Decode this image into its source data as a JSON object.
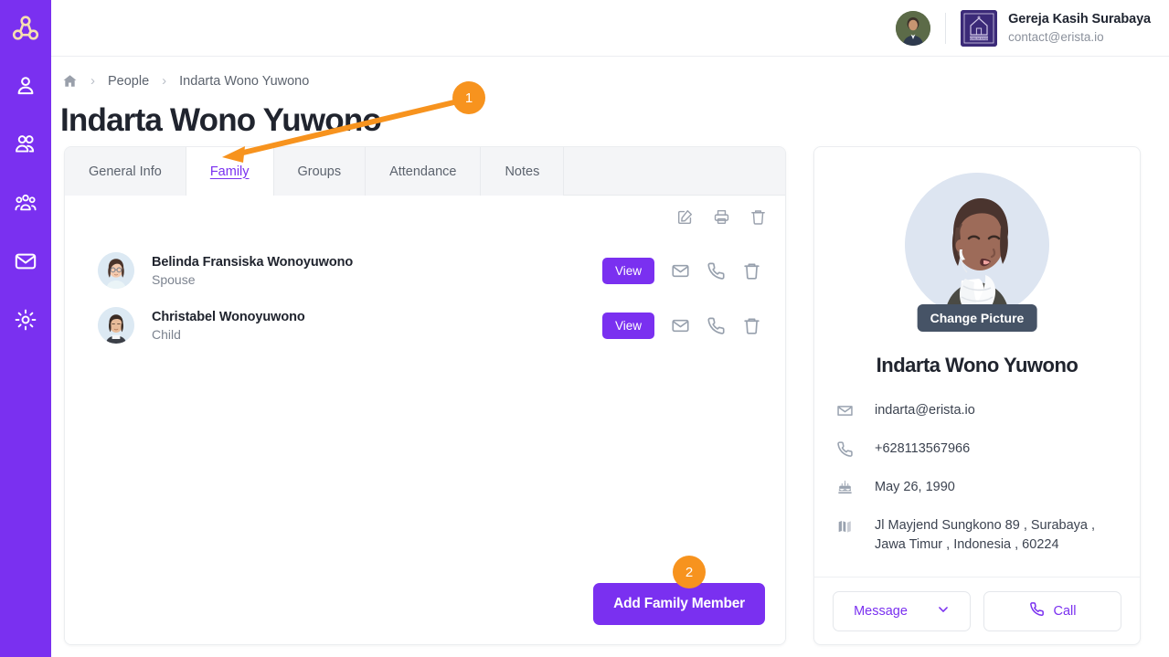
{
  "app": {
    "logo_icon": "triskelion-logo-icon",
    "brand_color": "#7a30f0",
    "accent_orange": "#f7931e"
  },
  "sidebar": {
    "items": [
      {
        "icon": "person-icon",
        "label": "Person"
      },
      {
        "icon": "people-pair-icon",
        "label": "People"
      },
      {
        "icon": "group-icon",
        "label": "Groups"
      },
      {
        "icon": "envelope-icon",
        "label": "Messages"
      },
      {
        "icon": "gear-icon",
        "label": "Settings"
      }
    ]
  },
  "topbar": {
    "user_avatar": "user-photo-avatar",
    "org_logo_icon": "church-building-icon",
    "org_name": "Gereja Kasih Surabaya",
    "org_email": "contact@erista.io"
  },
  "breadcrumb": {
    "home_icon": "home-icon",
    "separator": "›",
    "items": [
      {
        "label": "People"
      },
      {
        "label": "Indarta Wono Yuwono"
      }
    ]
  },
  "page": {
    "title": "Indarta Wono Yuwono"
  },
  "tabs": [
    {
      "label": "General Info",
      "active": false
    },
    {
      "label": "Family",
      "active": true
    },
    {
      "label": "Groups",
      "active": false
    },
    {
      "label": "Attendance",
      "active": false
    },
    {
      "label": "Notes",
      "active": false
    }
  ],
  "card_actions": [
    {
      "icon": "edit-icon",
      "label": "Edit"
    },
    {
      "icon": "print-icon",
      "label": "Print"
    },
    {
      "icon": "trash-icon",
      "label": "Delete"
    }
  ],
  "family_members": [
    {
      "avatar": "woman-glasses-avatar",
      "name": "Belinda Fransiska Wonoyuwono",
      "relation": "Spouse",
      "view_label": "View",
      "actions": [
        "envelope-icon",
        "phone-icon",
        "trash-icon"
      ]
    },
    {
      "avatar": "person-avatar",
      "name": "Christabel Wonoyuwono",
      "relation": "Child",
      "view_label": "View",
      "actions": [
        "envelope-icon",
        "phone-icon",
        "trash-icon"
      ]
    }
  ],
  "add_button_label": "Add Family Member",
  "profile": {
    "photo_icon": "person-illustration-avatar",
    "change_picture_label": "Change Picture",
    "name": "Indarta Wono Yuwono",
    "details": [
      {
        "icon": "envelope-icon",
        "value": "indarta@erista.io"
      },
      {
        "icon": "phone-icon",
        "value": "+628113567966"
      },
      {
        "icon": "cake-icon",
        "value": "May 26, 1990"
      },
      {
        "icon": "building-icon",
        "value": "Jl Mayjend Sungkono 89 , Surabaya , Jawa Timur , Indonesia , 60224"
      }
    ],
    "message_label": "Message",
    "message_chevron": "chevron-down-icon",
    "call_label": "Call",
    "call_icon": "phone-icon"
  },
  "annotations": [
    {
      "number": "1",
      "target": "family-tab"
    },
    {
      "number": "2",
      "target": "add-family-member-button"
    }
  ]
}
